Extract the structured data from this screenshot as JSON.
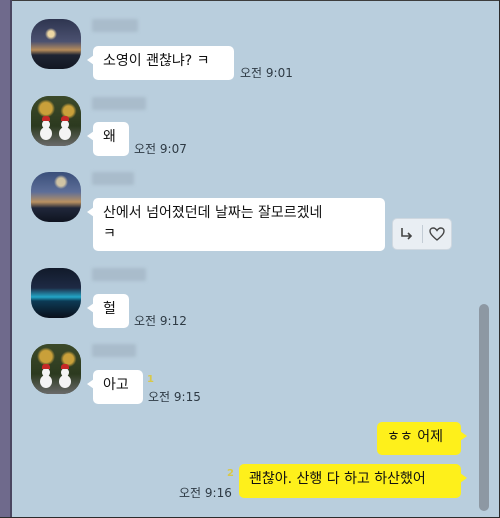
{
  "colors": {
    "background": "#b9cedd",
    "incoming_bubble": "#ffffff",
    "outgoing_bubble": "#fef01b",
    "unread_count": "#d8c84a",
    "scrollbar_thumb": "#8d98a3"
  },
  "messages": [
    {
      "direction": "incoming",
      "text": "소영이 괜찮냐? ㅋ",
      "time": "오전 9:01"
    },
    {
      "direction": "incoming",
      "text": "왜",
      "time": "오전 9:07"
    },
    {
      "direction": "incoming",
      "text_line1": "산에서 넘어졌던데 날짜는 잘모르겠네",
      "text_line2": "ㅋ"
    },
    {
      "direction": "incoming",
      "text": "헐",
      "time": "오전 9:12"
    },
    {
      "direction": "incoming",
      "text": "아고",
      "unread": "1",
      "time": "오전 9:15"
    },
    {
      "direction": "outgoing",
      "text": "ㅎㅎ 어제"
    },
    {
      "direction": "outgoing",
      "text": "괜찮아. 산행 다 하고 하산했어",
      "unread": "2",
      "time": "오전 9:16"
    }
  ],
  "actions": {
    "share_icon": "share-arrow-icon",
    "like_icon": "heart-icon"
  }
}
